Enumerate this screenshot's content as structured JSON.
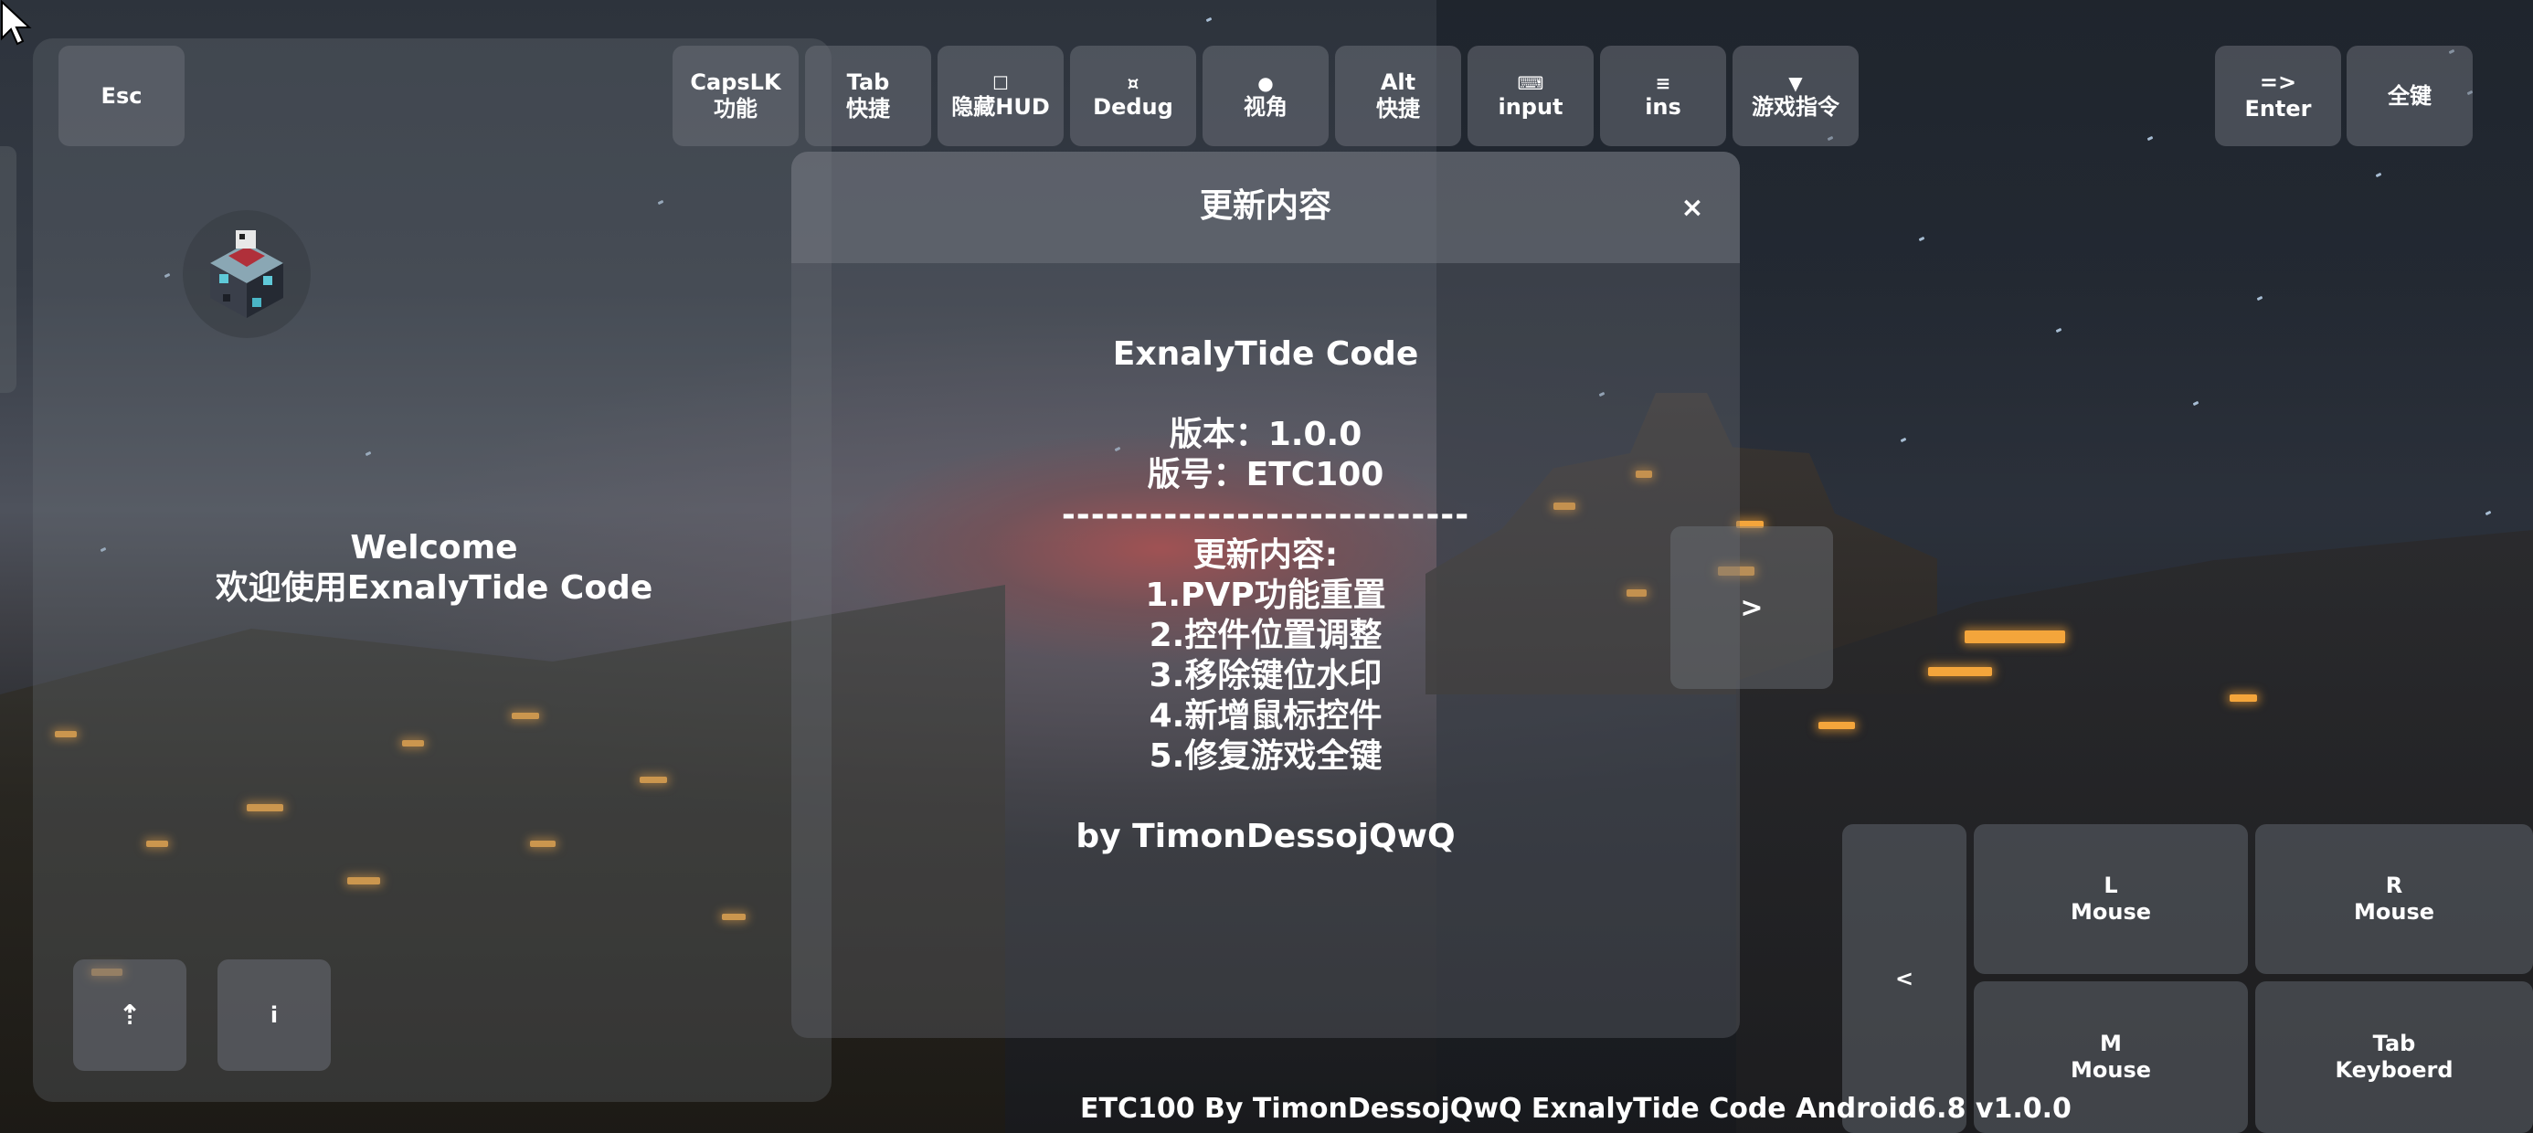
{
  "top_keys": {
    "esc": "Esc",
    "capslk": [
      "CapsLK",
      "功能"
    ],
    "tab": [
      "Tab",
      "快捷"
    ],
    "hud": {
      "icon": "square-icon",
      "label": "隐藏HUD",
      "glyph": "☐"
    },
    "debug": {
      "icon": "crosshair-icon",
      "label": "Dedug",
      "glyph": "¤"
    },
    "view": {
      "icon": "dot-icon",
      "label": "视角",
      "glyph": "●"
    },
    "alt": [
      "Alt",
      "快捷"
    ],
    "input": {
      "icon": "keyboard-icon",
      "label": "input",
      "glyph": "⌨"
    },
    "ins": {
      "icon": "menu-icon",
      "label": "ins",
      "glyph": "≡"
    },
    "game_cmd": {
      "icon": "triangle-down-icon",
      "label": "游戏指令",
      "glyph": "▼"
    },
    "enter": [
      "=>",
      "Enter"
    ],
    "all_keys": "全键"
  },
  "welcome": {
    "line1": "Welcome",
    "line2": "欢迎使用ExnalyTide Code"
  },
  "update_panel": {
    "title": "更新内容",
    "close": "×",
    "app_name": "ExnalyTide Code",
    "version": "版本：1.0.0",
    "build": "版号：ETC100",
    "divider": "----------------------------",
    "changes_heading": "更新内容:",
    "changes": [
      "1.PVP功能重置",
      "2.控件位置调整",
      "3.移除键位水印",
      "4.新增鼠标控件",
      "5.修复游戏全键"
    ],
    "author": "by TimonDessojQwQ"
  },
  "next_button": ">",
  "bottom_left": {
    "upload_glyph": "⇡",
    "info": "i"
  },
  "mouse_controls": {
    "collapse": "<",
    "left": [
      "L",
      "Mouse"
    ],
    "right": [
      "R",
      "Mouse"
    ],
    "middle": [
      "M",
      "Mouse"
    ],
    "tab_keyboard": [
      "Tab",
      "Keyboerd"
    ]
  },
  "footer": "ETC100 By TimonDessojQwQ ExnalyTide Code Android6.8 v1.0.0",
  "colors": {
    "panel": "#6e737a",
    "sunset": "#cd413c",
    "lantern": "#f4a53b"
  }
}
